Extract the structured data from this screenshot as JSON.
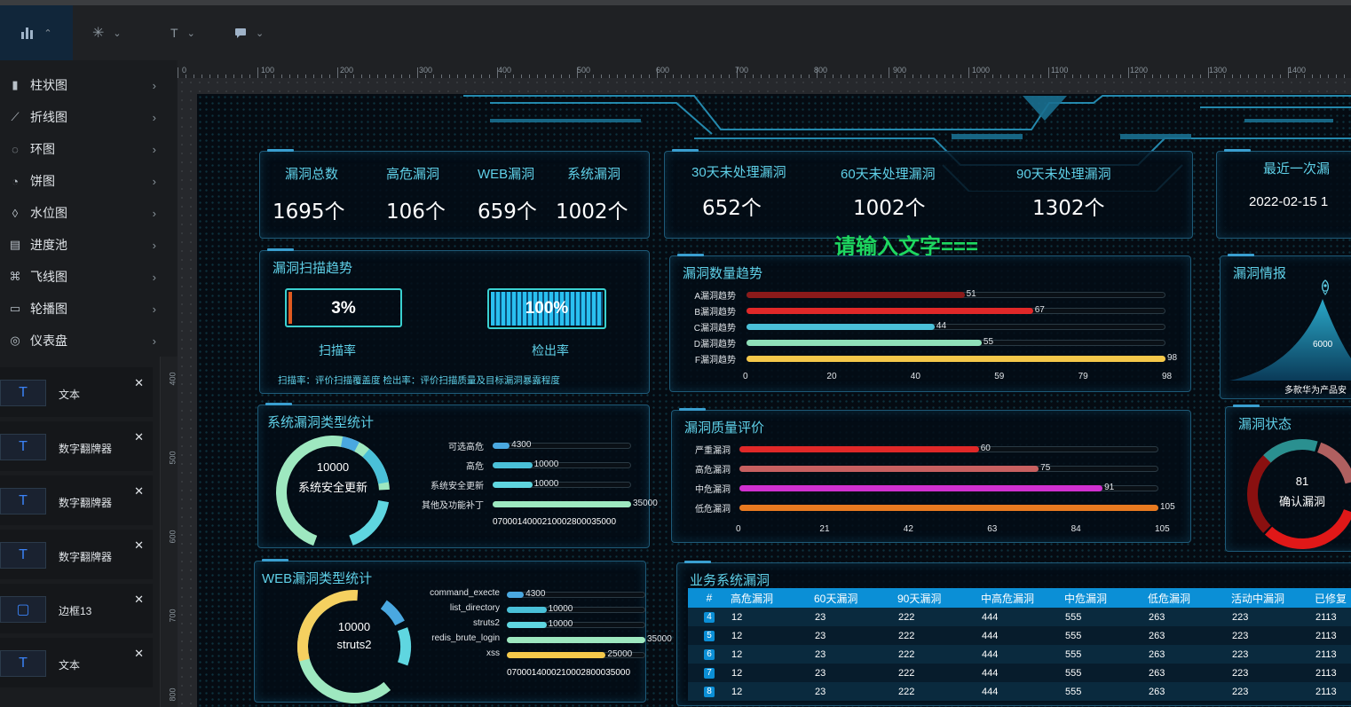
{
  "toolbar": {
    "items": [
      {
        "icon": "bar-chart-icon",
        "caret": "⌃"
      },
      {
        "icon": "sparkle-icon",
        "caret": "⌄"
      },
      {
        "icon": "text-icon",
        "label": "T",
        "caret": "⌄"
      },
      {
        "icon": "comment-icon",
        "caret": "⌄"
      }
    ]
  },
  "menu": [
    {
      "label": "柱状图",
      "icon": "bar-chart-icon"
    },
    {
      "label": "折线图",
      "icon": "line-chart-icon"
    },
    {
      "label": "环图",
      "icon": "ring-chart-icon"
    },
    {
      "label": "饼图",
      "icon": "pie-chart-icon"
    },
    {
      "label": "水位图",
      "icon": "water-drop-icon"
    },
    {
      "label": "进度池",
      "icon": "progress-icon"
    },
    {
      "label": "飞线图",
      "icon": "flyline-icon"
    },
    {
      "label": "轮播图",
      "icon": "carousel-icon"
    },
    {
      "label": "仪表盘",
      "icon": "gauge-icon"
    }
  ],
  "layers": [
    {
      "icon": "T",
      "name": "文本"
    },
    {
      "icon": "T",
      "name": "数字翻牌器"
    },
    {
      "icon": "T",
      "name": "数字翻牌器"
    },
    {
      "icon": "T",
      "name": "数字翻牌器"
    },
    {
      "icon": "▢",
      "name": "边框13"
    },
    {
      "icon": "T",
      "name": "文本"
    }
  ],
  "ruler_h": [
    "0",
    "100",
    "200",
    "300",
    "400",
    "500",
    "600",
    "700",
    "800",
    "900",
    "1000",
    "1100",
    "1200",
    "1300",
    "1400"
  ],
  "ruler_v": [
    "400",
    "500",
    "600",
    "700",
    "800"
  ],
  "screen": {
    "vuln_stats": {
      "labels": [
        "漏洞总数",
        "高危漏洞",
        "WEB漏洞",
        "系统漏洞"
      ],
      "values": [
        "1695个",
        "106个",
        "659个",
        "1002个"
      ]
    },
    "pending_stats": {
      "labels": [
        "30天未处理漏洞",
        "60天未处理漏洞",
        "90天未处理漏洞"
      ],
      "values": [
        "652个",
        "1002个",
        "1302个"
      ]
    },
    "recent": {
      "label": "最近一次漏",
      "value": "2022-02-15 1"
    },
    "overlay_text": "请输入文字===",
    "scan_trend": {
      "title": "漏洞扫描趋势",
      "scan_rate": "3%",
      "scan_rate_fraction": 0.03,
      "scan_label": "扫描率",
      "detect_rate": "100%",
      "detect_rate_fraction": 1.0,
      "detect_label": "检出率",
      "note": "扫描率：评价扫描覆盖度 检出率：评价扫描质量及目标漏洞暴露程度"
    },
    "qty_trend": {
      "title": "漏洞数量趋势",
      "rows": [
        {
          "label": "A漏洞趋势",
          "value": 51,
          "color": "#8b1a1a"
        },
        {
          "label": "B漏洞趋势",
          "value": 67,
          "color": "#e02828"
        },
        {
          "label": "C漏洞趋势",
          "value": 44,
          "color": "#4ac0d8"
        },
        {
          "label": "D漏洞趋势",
          "value": 55,
          "color": "#8fe0b8"
        },
        {
          "label": "F漏洞趋势",
          "value": 98,
          "color": "#f5c84a"
        }
      ],
      "max": 98,
      "ticks": [
        "0",
        "20",
        "40",
        "59",
        "79",
        "98"
      ]
    },
    "intel": {
      "title": "漏洞情报",
      "value": "6000",
      "caption": "多款华为产品安"
    },
    "sys_type": {
      "title": "系统漏洞类型统计",
      "center_value": "10000",
      "center_label": "系统安全更新",
      "rows": [
        {
          "label": "可选高危",
          "value": 4300,
          "text": "4300",
          "color": "#4aa8e0"
        },
        {
          "label": "高危",
          "value": 10000,
          "text": "10000",
          "color": "#4ac0d8"
        },
        {
          "label": "系统安全更新",
          "value": 10000,
          "text": "10000",
          "color": "#5fd6e0"
        },
        {
          "label": "其他及功能补丁",
          "value": 35000,
          "text": "35000",
          "color": "#9ee8c0"
        }
      ],
      "max": 35000,
      "axis": "070001400021000280003500​0"
    },
    "quality": {
      "title": "漏洞质量评价",
      "rows": [
        {
          "label": "严重漏洞",
          "value": 60,
          "color": "#e02828"
        },
        {
          "label": "高危漏洞",
          "value": 75,
          "color": "#c86060"
        },
        {
          "label": "中危漏洞",
          "value": 91,
          "color": "#d030d0"
        },
        {
          "label": "低危漏洞",
          "value": 105,
          "color": "#e87a20"
        }
      ],
      "max": 105,
      "ticks": [
        "0",
        "21",
        "42",
        "63",
        "84",
        "105"
      ]
    },
    "status": {
      "title": "漏洞状态",
      "value": "81",
      "label": "确认漏洞"
    },
    "web_type": {
      "title": "WEB漏洞类型统计",
      "center_value": "10000",
      "center_label": "struts2",
      "rows": [
        {
          "label": "command_execte",
          "value": 4300,
          "text": "4300",
          "color": "#4aa8e0"
        },
        {
          "label": "list_directory",
          "value": 10000,
          "text": "10000",
          "color": "#4ac0d8"
        },
        {
          "label": "struts2",
          "value": 10000,
          "text": "10000",
          "color": "#5fd6e0"
        },
        {
          "label": "redis_brute_login",
          "value": 35000,
          "text": "35000",
          "color": "#9ee8c0"
        },
        {
          "label": "xss",
          "value": 25000,
          "text": "25000",
          "color": "#f5c84a"
        }
      ],
      "max": 35000,
      "axis": "070001400021000280003500​0"
    },
    "biz": {
      "title": "业务系统漏洞",
      "headers": [
        "#",
        "高危漏洞",
        "60天漏洞",
        "90天漏洞",
        "中高危漏洞",
        "中危漏洞",
        "低危漏洞",
        "活动中漏洞",
        "已修复"
      ],
      "rows": [
        [
          "4",
          "12",
          "23",
          "222",
          "444",
          "555",
          "263",
          "223",
          "2113"
        ],
        [
          "5",
          "12",
          "23",
          "222",
          "444",
          "555",
          "263",
          "223",
          "2113"
        ],
        [
          "6",
          "12",
          "23",
          "222",
          "444",
          "555",
          "263",
          "223",
          "2113"
        ],
        [
          "7",
          "12",
          "23",
          "222",
          "444",
          "555",
          "263",
          "223",
          "2113"
        ],
        [
          "8",
          "12",
          "23",
          "222",
          "444",
          "555",
          "263",
          "223",
          "2113"
        ]
      ]
    }
  },
  "colors": {
    "accent": "#5fd0e8",
    "panel_border": "#1e5a78",
    "header_blue": "#0b8fd6",
    "overlay_green": "#1ed760"
  }
}
